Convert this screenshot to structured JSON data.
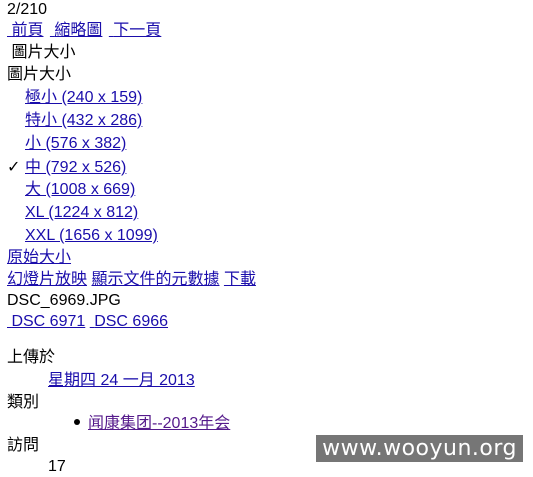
{
  "page_counter": "2/210",
  "nav": {
    "prev": "前頁",
    "thumbnails": "縮略圖",
    "next": "下一頁"
  },
  "size_menu": {
    "toggle_label": "圖片大小",
    "heading": "圖片大小",
    "items": [
      {
        "label": "極小 (240 x 159)",
        "checked": false
      },
      {
        "label": "特小 (432 x 286)",
        "checked": false
      },
      {
        "label": "小 (576 x 382)",
        "checked": false
      },
      {
        "label": "中 (792 x 526)",
        "checked": true
      },
      {
        "label": "大 (1008 x 669)",
        "checked": false
      },
      {
        "label": "XL (1224 x 812)",
        "checked": false
      },
      {
        "label": "XXL (1656 x 1099)",
        "checked": false
      }
    ],
    "original": "原始大小",
    "check_glyph": "✓"
  },
  "actions": {
    "slideshow": "幻燈片放映",
    "metadata": "顯示文件的元數據",
    "download": "下載"
  },
  "file_name": "DSC_6969.JPG",
  "related": {
    "prev_image": "DSC 6971",
    "next_image": "DSC 6966"
  },
  "info": {
    "uploaded_label": "上傳於",
    "uploaded_date": "星期四 24 一月 2013",
    "category_label": "類別",
    "category_item": "闻康集团--2013年会",
    "visits_label": "訪問",
    "visits_count": "17"
  },
  "watermark": "www.wooyun.org"
}
